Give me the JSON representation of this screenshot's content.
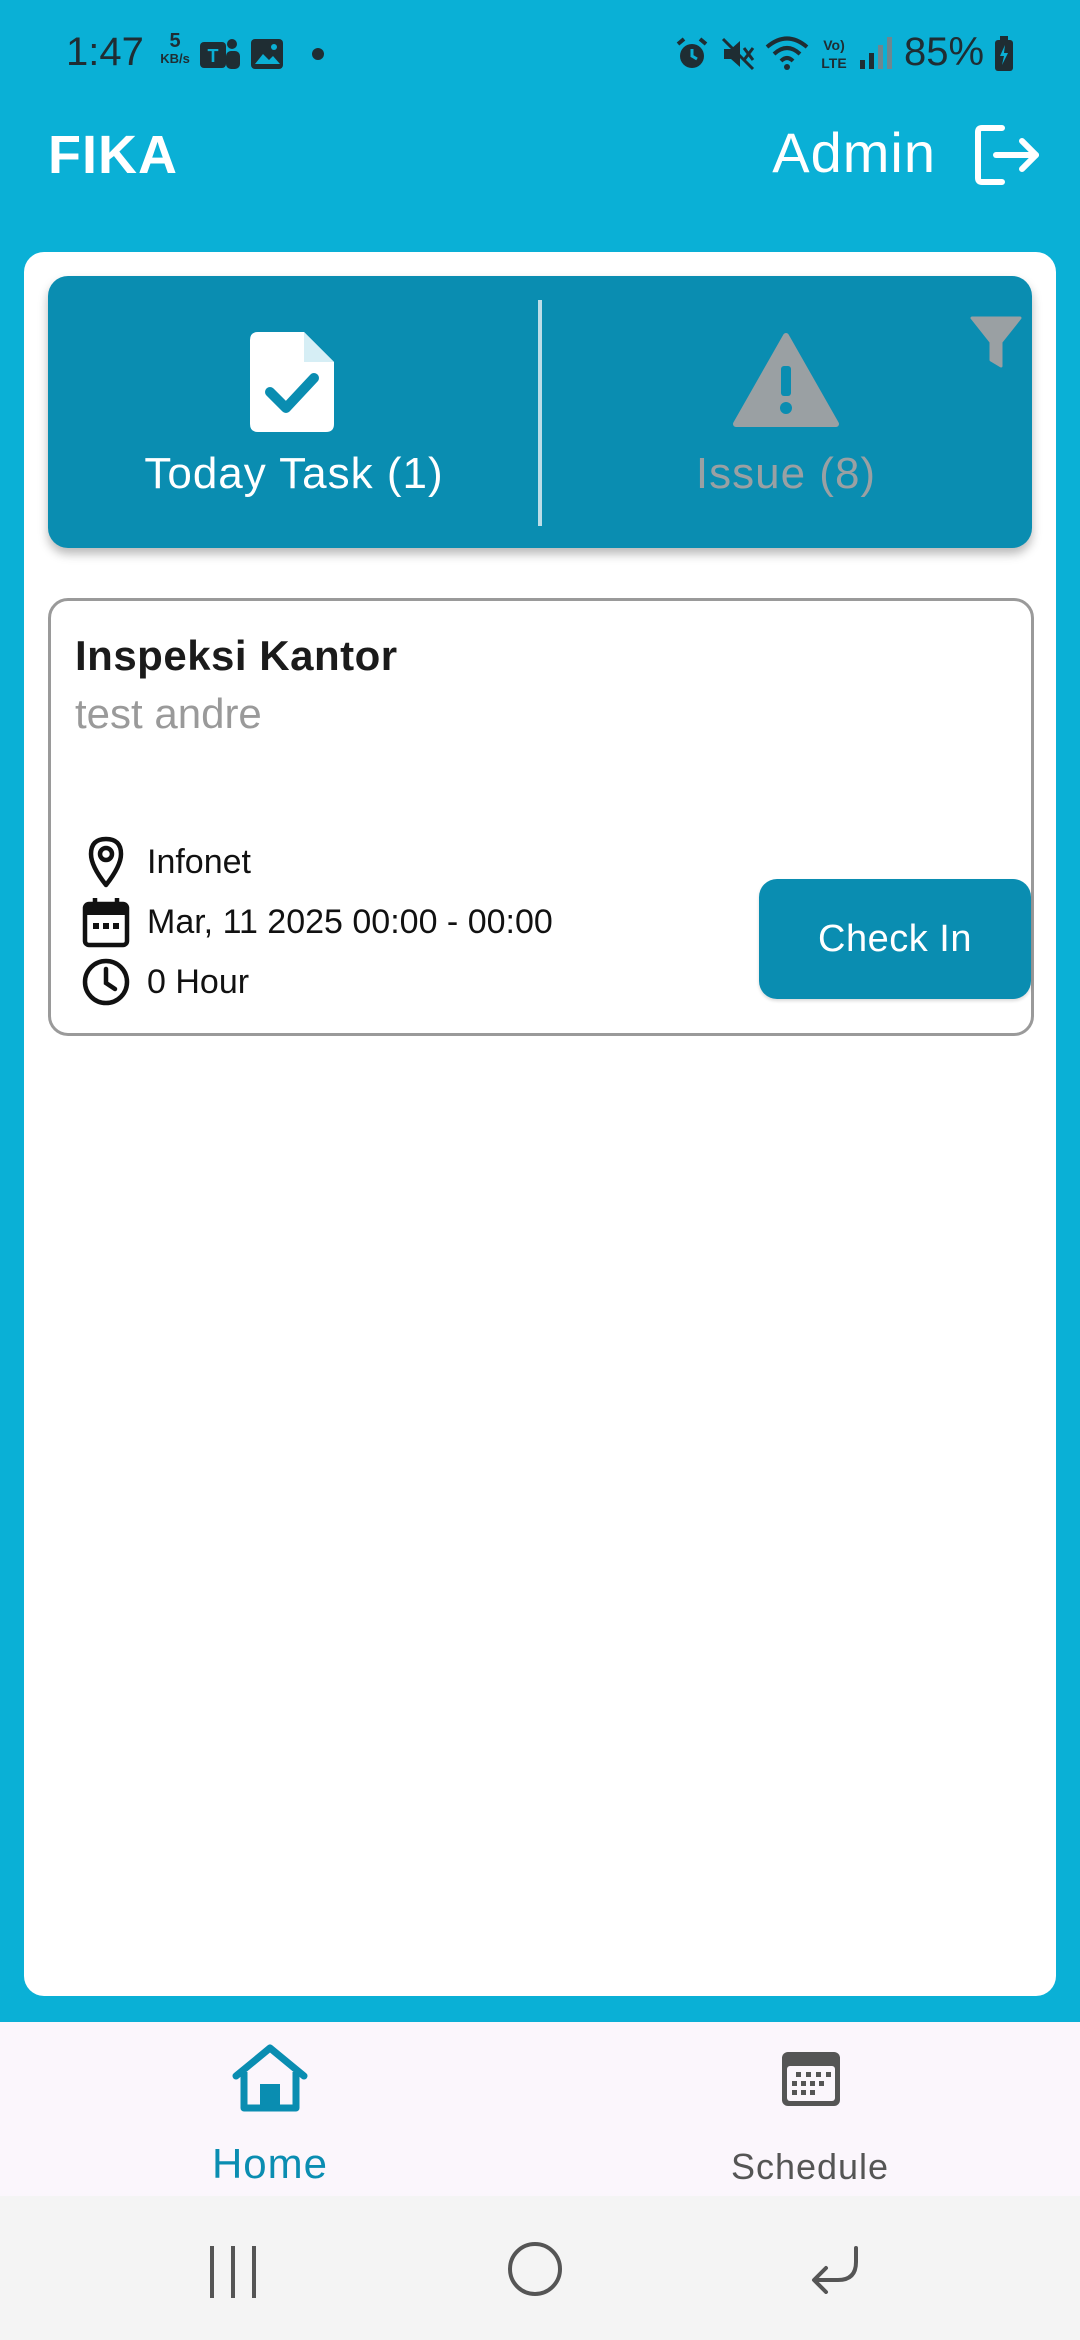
{
  "status_bar": {
    "time": "1:47",
    "net_speed_value": "5",
    "net_speed_unit": "KB/s",
    "battery": "85%",
    "icons": [
      "teams-icon",
      "gallery-icon",
      "dot-icon",
      "alarm-icon",
      "mute-icon",
      "wifi-icon",
      "volte-icon",
      "signal-icon",
      "battery-icon"
    ]
  },
  "header": {
    "app_title": "FIKA",
    "user_name": "Admin",
    "logout_icon": "logout-icon"
  },
  "tabs": {
    "today_label": "Today Task (1)",
    "issue_label": "Issue (8)",
    "active": "today",
    "filter_icon": "filter-icon"
  },
  "tasks": [
    {
      "title": "Inspeksi Kantor",
      "subtitle": "test andre",
      "location": "Infonet",
      "datetime": "Mar, 11 2025 00:00 - 00:00",
      "duration": "0 Hour",
      "action_label": "Check In"
    }
  ],
  "bottom_nav": {
    "home_label": "Home",
    "schedule_label": "Schedule",
    "active": "home"
  },
  "colors": {
    "background": "#0ab0d6",
    "primary": "#0a8db1",
    "inactive_text": "#9aa0a3"
  }
}
